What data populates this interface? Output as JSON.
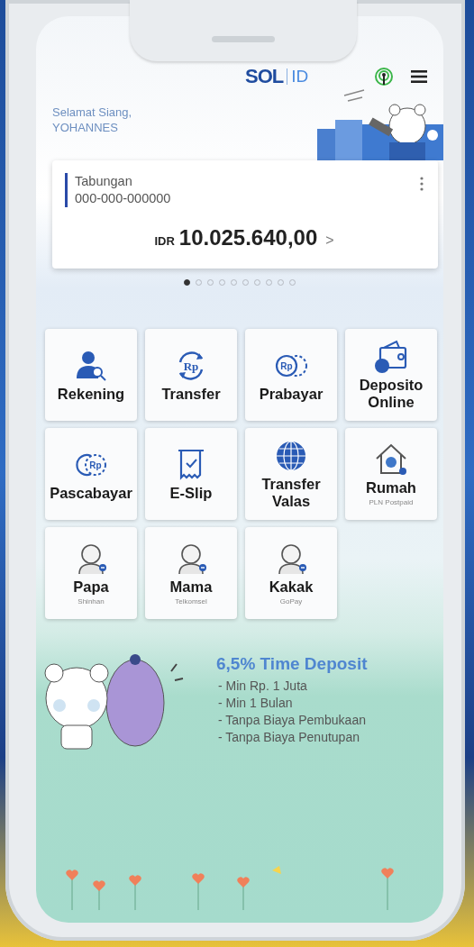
{
  "header": {
    "logo": "SOL",
    "logo_suffix": "ID"
  },
  "greeting": {
    "text": "Selamat Siang,",
    "name": "YOHANNES"
  },
  "account_card": {
    "type": "Tabungan",
    "number": "000-000-000000",
    "currency": "IDR",
    "balance": "10.025.640,00",
    "chevron": ">"
  },
  "carousel_dots": [
    {
      "selected": true
    },
    {
      "selected": false
    },
    {
      "selected": false
    },
    {
      "selected": false
    },
    {
      "selected": false
    },
    {
      "selected": false
    },
    {
      "selected": false
    },
    {
      "selected": false
    },
    {
      "selected": false
    },
    {
      "selected": false
    }
  ],
  "menu": [
    {
      "label": "Rekening",
      "kind": "account"
    },
    {
      "label": "Transfer",
      "kind": "transfer",
      "icon_text": "Rp"
    },
    {
      "label": "Prabayar",
      "kind": "prepaid",
      "icon_text": "Rp"
    },
    {
      "label": "Deposito Online",
      "kind": "deposit"
    },
    {
      "label": "Pascabayar",
      "kind": "postpaid",
      "icon_text": "Rp"
    },
    {
      "label": "E-Slip",
      "kind": "slip"
    },
    {
      "label": "Transfer Valas",
      "kind": "forex"
    },
    {
      "label": "Rumah",
      "sublabel": "PLN Postpaid",
      "kind": "home"
    },
    {
      "label": "Papa",
      "sublabel": "Shinhan",
      "kind": "contact"
    },
    {
      "label": "Mama",
      "sublabel": "Telkomsel",
      "kind": "contact"
    },
    {
      "label": "Kakak",
      "sublabel": "GoPay",
      "kind": "contact"
    }
  ],
  "promo": {
    "title": "6,5% Time Deposit",
    "points": [
      "- Min Rp. 1 Juta",
      "- Min 1 Bulan",
      "- Tanpa Biaya Pembukaan",
      "- Tanpa Biaya Penutupan"
    ]
  }
}
